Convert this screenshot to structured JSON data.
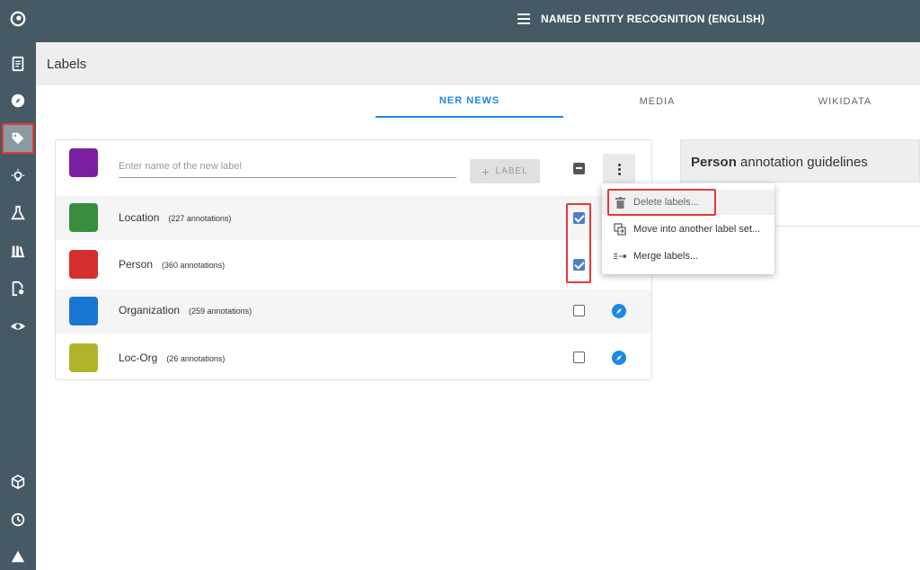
{
  "topbar": {
    "title": "NAMED ENTITY RECOGNITION (ENGLISH)"
  },
  "page": {
    "heading": "Labels"
  },
  "tabs": [
    {
      "label": "NER NEWS",
      "active": true
    },
    {
      "label": "MEDIA",
      "active": false
    },
    {
      "label": "WIKIDATA",
      "active": false
    }
  ],
  "new_label": {
    "placeholder": "Enter name of the new label",
    "button": "LABEL",
    "swatch_color": "#7b1fa2"
  },
  "labels": [
    {
      "name": "Location",
      "count": "(227 annotations)",
      "color": "#388e3c",
      "checked": true
    },
    {
      "name": "Person",
      "count": "(360 annotations)",
      "color": "#d32f2f",
      "checked": true
    },
    {
      "name": "Organization",
      "count": "(259 annotations)",
      "color": "#1976d2",
      "checked": false
    },
    {
      "name": "Loc-Org",
      "count": "(26 annotations)",
      "color": "#afb42b",
      "checked": false
    }
  ],
  "guidelines": {
    "bold": "Person",
    "rest": " annotation guidelines"
  },
  "menu": [
    {
      "label": "Delete labels...",
      "icon": "trash-icon"
    },
    {
      "label": "Move into another label set...",
      "icon": "move-icon"
    },
    {
      "label": "Merge labels...",
      "icon": "merge-icon"
    }
  ],
  "rail_icons": [
    "logo-icon",
    "documents-icon",
    "compass-icon",
    "tag-icon",
    "lightbulb-icon",
    "flask-icon",
    "library-icon",
    "file-settings-icon",
    "eye-settings-icon",
    "cube-icon",
    "history-icon",
    "triangle-logo-icon"
  ],
  "colors": {
    "rail": "#455a64",
    "accent": "#1e88e5",
    "highlight": "#e53935"
  }
}
